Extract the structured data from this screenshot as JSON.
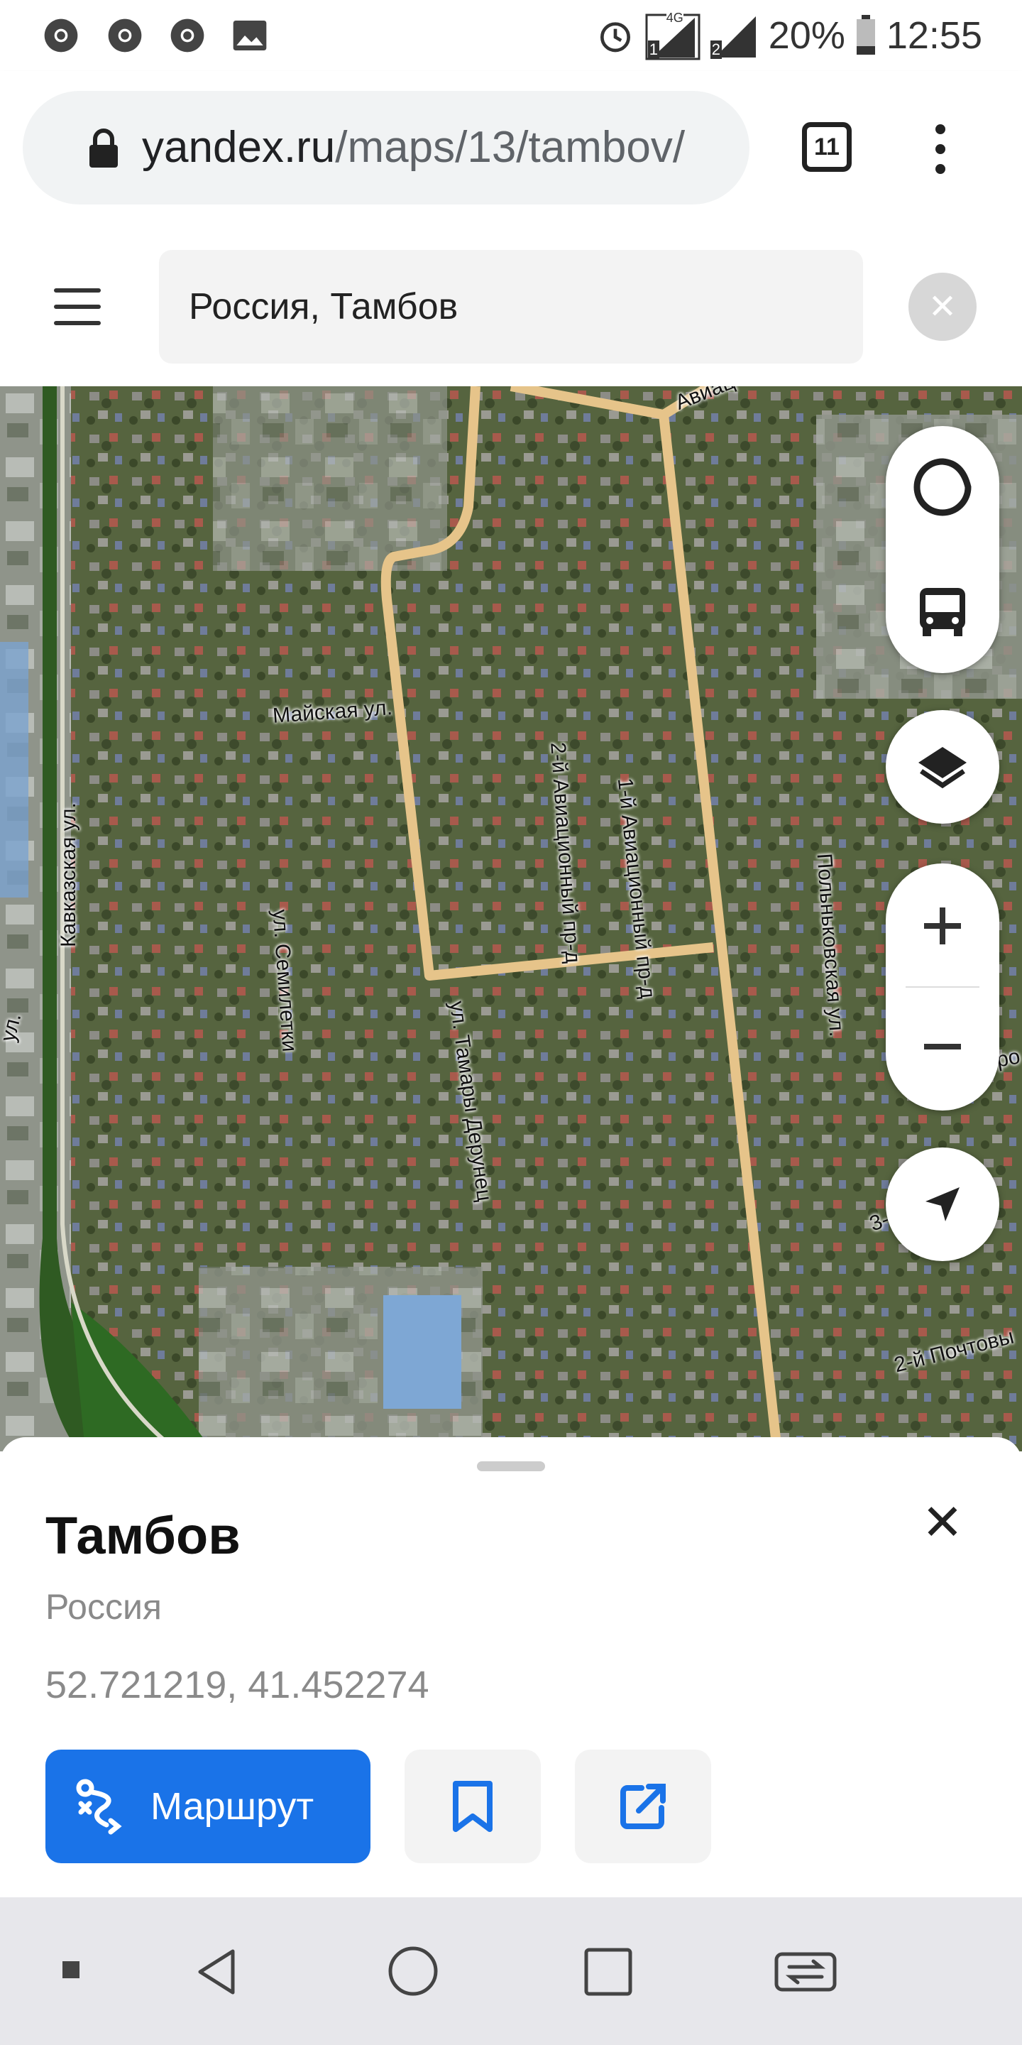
{
  "status_bar": {
    "notification_icons": [
      "chrome-icon",
      "chrome-icon",
      "chrome-icon",
      "image-icon"
    ],
    "network_label": "4G",
    "sim1": "1",
    "sim2": "2",
    "battery": "20%",
    "time": "12:55"
  },
  "browser": {
    "url_domain": "yandex.ru",
    "url_path": "/maps/13/tambov/",
    "tab_count": "11"
  },
  "header": {
    "search_value": "Россия, Тамбов"
  },
  "map": {
    "labels": {
      "avia": "Авиац",
      "mayskaya": "Майская ул.",
      "kavkazskaya": "Кавказская ул.",
      "semiletki": "ул. Семилетки",
      "tamary": "ул. Тамары Дерунец",
      "aviacionny2": "2-й Авиационный пр-д",
      "aviacionny1": "1-й Авиационный пр-д",
      "polnikovskaya": "Польньковская ул.",
      "pochtoviy": "2-й Почтовы",
      "edge_left": "ул.",
      "edge_right_top": "ро",
      "edge_right_3": "3-"
    },
    "controls": [
      "alice-icon",
      "transport-icon",
      "layers-icon",
      "zoom-in-icon",
      "zoom-out-icon",
      "location-icon"
    ]
  },
  "card": {
    "title": "Тамбов",
    "subtitle": "Россия",
    "coordinates": "52.721219, 41.452274",
    "route_label": "Маршрут",
    "accent": "#1a73e8"
  }
}
